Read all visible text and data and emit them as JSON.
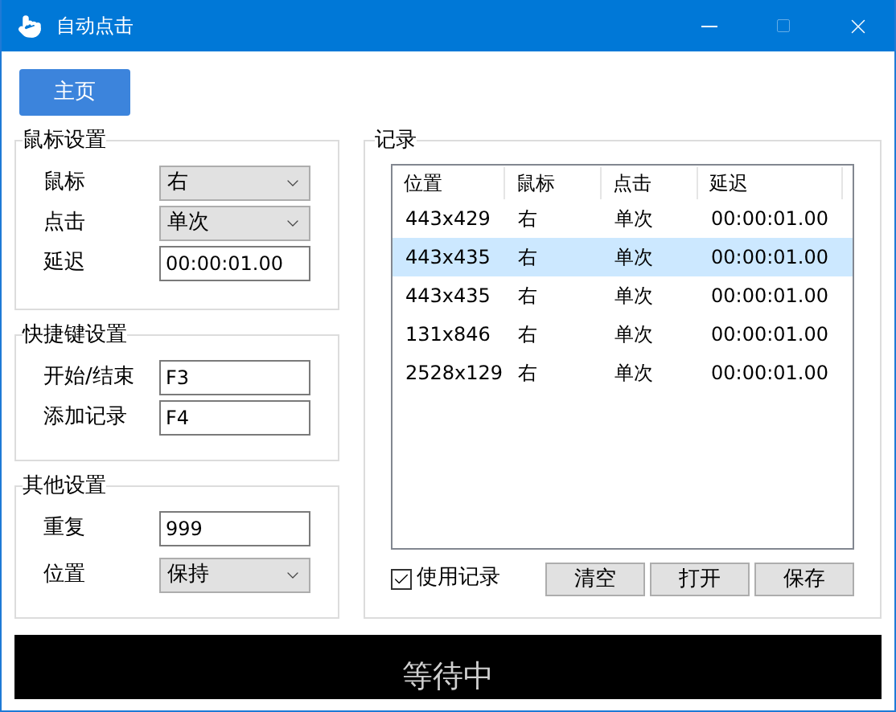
{
  "window": {
    "title": "自动点击"
  },
  "home_button": "主页",
  "groups": [
    {
      "title": "鼠标设置",
      "fields": [
        {
          "label": "鼠标",
          "kind": "dropdown",
          "value": "右"
        },
        {
          "label": "点击",
          "kind": "dropdown",
          "value": "单次"
        },
        {
          "label": "延迟",
          "kind": "text",
          "value": "00:00:01.00"
        }
      ]
    },
    {
      "title": "快捷键设置",
      "fields": [
        {
          "label": "开始/结束",
          "kind": "text",
          "value": "F3"
        },
        {
          "label": "添加记录",
          "kind": "text",
          "value": "F4"
        }
      ]
    },
    {
      "title": "其他设置",
      "fields": [
        {
          "label": "重复",
          "kind": "text",
          "value": "999"
        },
        {
          "label": "位置",
          "kind": "dropdown",
          "value": "保持"
        }
      ]
    }
  ],
  "records": {
    "title": "记录",
    "table": {
      "columns": [
        "位置",
        "鼠标",
        "点击",
        "延迟"
      ],
      "rows": [
        {
          "cells": [
            "443x429",
            "右",
            "单次",
            "00:00:01.00"
          ],
          "selected": false
        },
        {
          "cells": [
            "443x435",
            "右",
            "单次",
            "00:00:01.00"
          ],
          "selected": true
        },
        {
          "cells": [
            "443x435",
            "右",
            "单次",
            "00:00:01.00"
          ],
          "selected": false
        },
        {
          "cells": [
            "131x846",
            "右",
            "单次",
            "00:00:01.00"
          ],
          "selected": false
        },
        {
          "cells": [
            "2528x129",
            "右",
            "单次",
            "00:00:01.00"
          ],
          "selected": false
        }
      ]
    },
    "use_records": {
      "label": "使用记录",
      "checked": true
    },
    "buttons": [
      "清空",
      "打开",
      "保存"
    ]
  },
  "status": "等待中"
}
